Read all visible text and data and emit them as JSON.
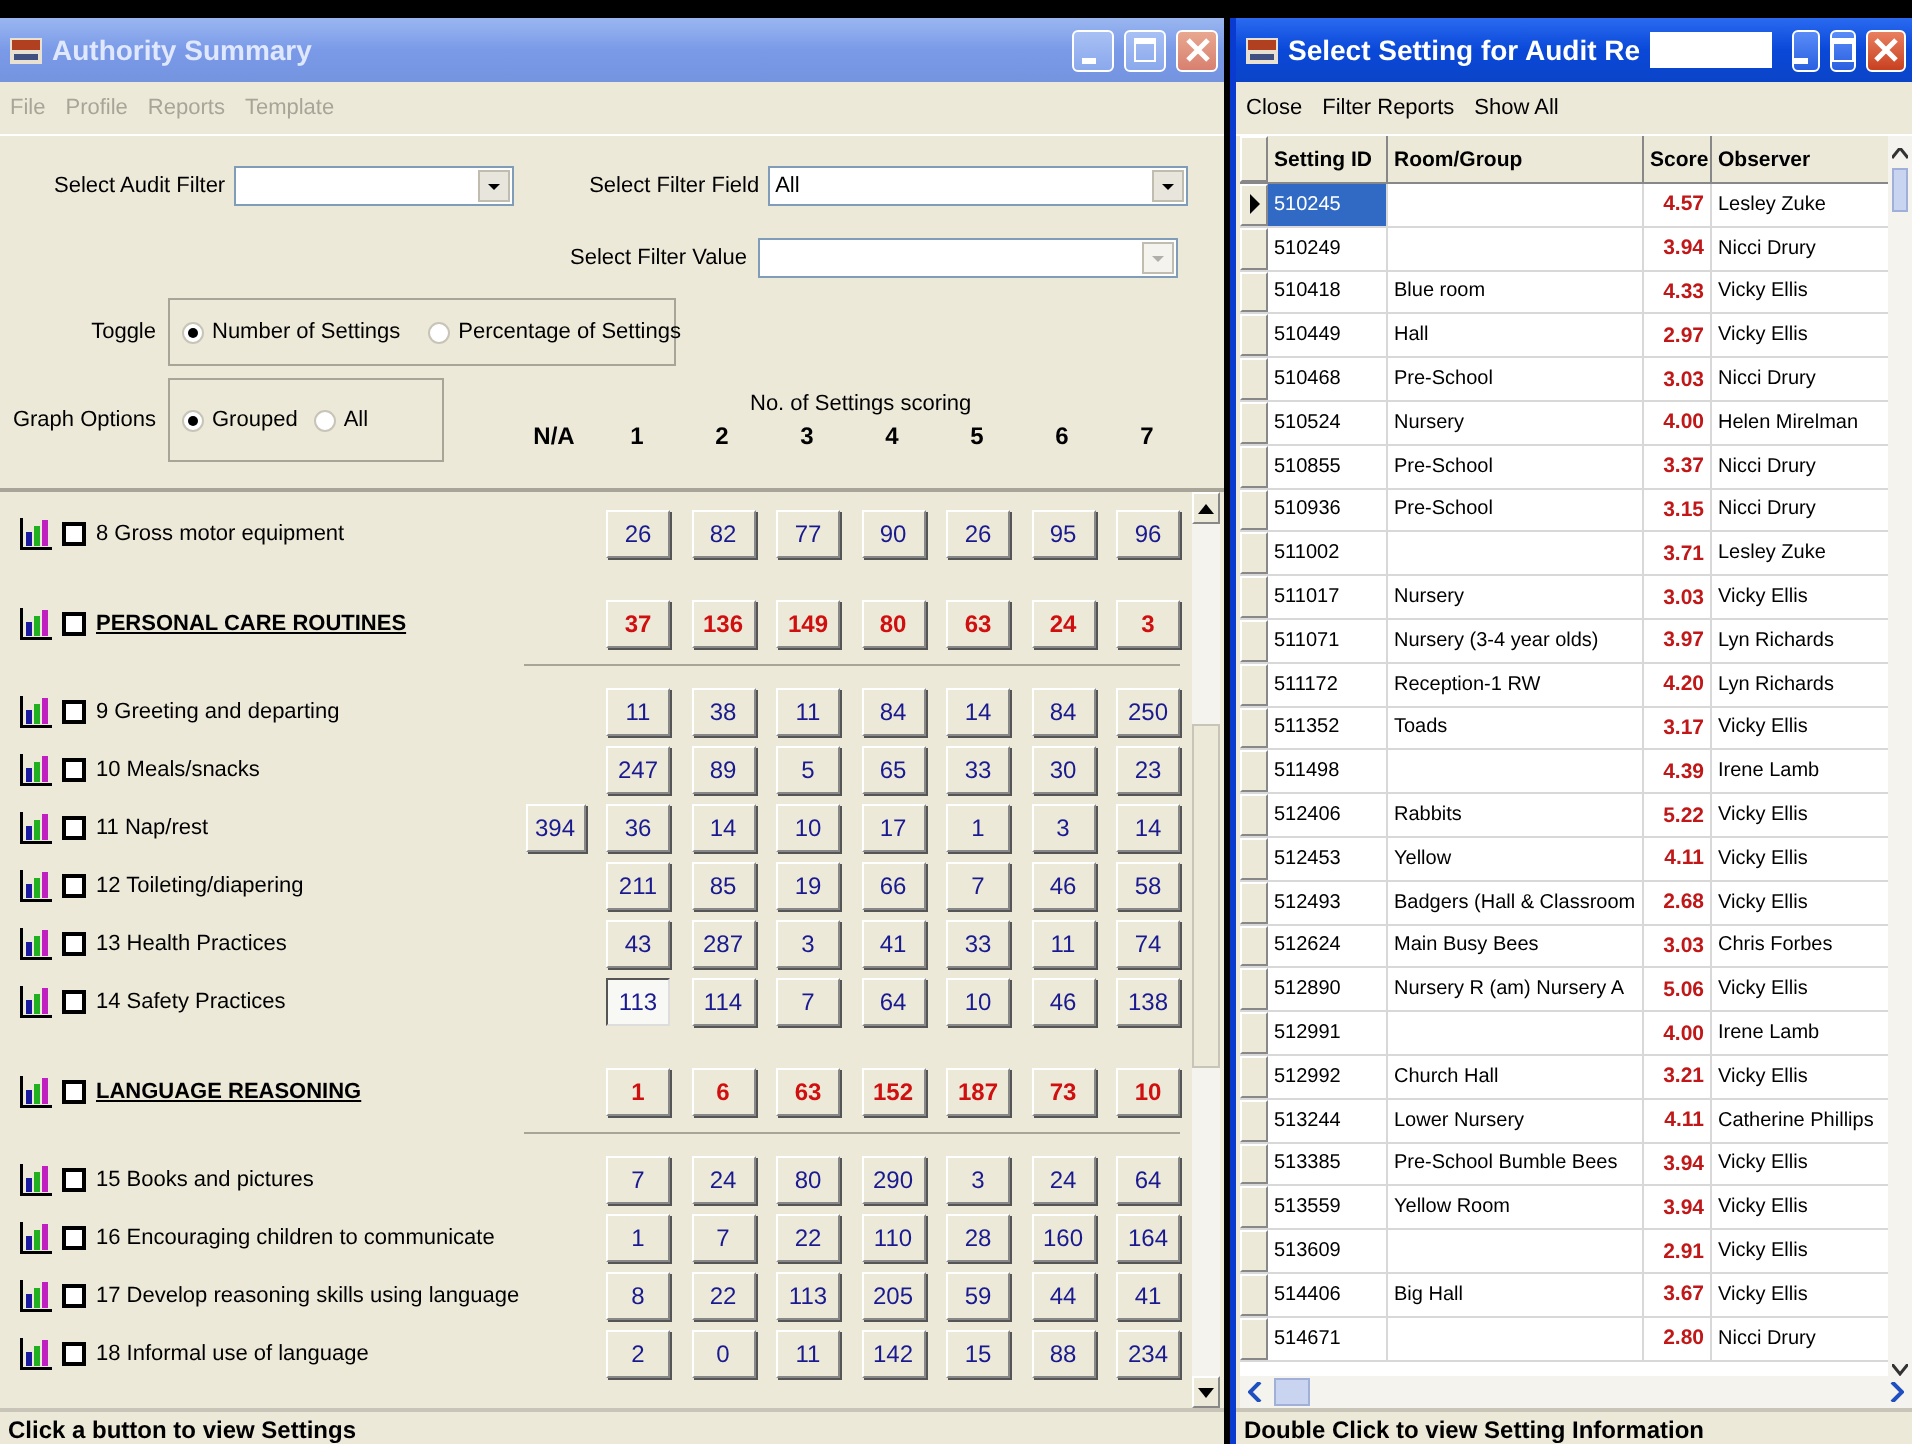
{
  "summary_window": {
    "title": "Authority Summary",
    "active": false,
    "menu": [
      {
        "label": "File",
        "disabled": true
      },
      {
        "label": "Profile",
        "disabled": true
      },
      {
        "label": "Reports",
        "disabled": true
      },
      {
        "label": "Template",
        "disabled": true
      }
    ],
    "audit_filter": {
      "label": "Select Audit Filter",
      "disabled": false
    },
    "filter_field": {
      "label": "Select Filter Field",
      "value": "All",
      "disabled": false
    },
    "filter_value": {
      "label": "Select Filter Value",
      "disabled": true
    },
    "toggle": {
      "label": "Toggle",
      "options": [
        {
          "label": "Number of Settings",
          "selected": true
        },
        {
          "label": "Percentage of Settings",
          "selected": false
        }
      ]
    },
    "graph_options": {
      "label": "Graph Options",
      "options": [
        {
          "label": "Grouped",
          "selected": true
        },
        {
          "label": "All",
          "selected": false
        }
      ]
    },
    "scores_caption": "No. of Settings scoring",
    "na_header": "N/A",
    "columns": [
      "1",
      "2",
      "3",
      "4",
      "5",
      "6",
      "7"
    ],
    "rows": [
      {
        "kind": "item",
        "label": "8  Gross motor equipment",
        "checked": false,
        "na": "",
        "cells": [
          {
            "text": "26",
            "selected": false
          },
          {
            "text": "82",
            "selected": false
          },
          {
            "text": "77",
            "selected": false
          },
          {
            "text": "90",
            "selected": false
          },
          {
            "text": "26",
            "selected": false
          },
          {
            "text": "95",
            "selected": false
          },
          {
            "text": "96",
            "selected": false
          }
        ]
      },
      {
        "kind": "group",
        "label": "PERSONAL CARE ROUTINES",
        "checked": false,
        "na": "",
        "cells": [
          {
            "text": "37",
            "selected": false
          },
          {
            "text": "136",
            "selected": false
          },
          {
            "text": "149",
            "selected": false
          },
          {
            "text": "80",
            "selected": false
          },
          {
            "text": "63",
            "selected": false
          },
          {
            "text": "24",
            "selected": false
          },
          {
            "text": "3",
            "selected": false
          }
        ]
      },
      {
        "kind": "item",
        "label": "9  Greeting and departing",
        "checked": false,
        "na": "",
        "cells": [
          {
            "text": "11",
            "selected": false
          },
          {
            "text": "38",
            "selected": false
          },
          {
            "text": "11",
            "selected": false
          },
          {
            "text": "84",
            "selected": false
          },
          {
            "text": "14",
            "selected": false
          },
          {
            "text": "84",
            "selected": false
          },
          {
            "text": "250",
            "selected": false
          }
        ]
      },
      {
        "kind": "item",
        "label": "10 Meals/snacks",
        "checked": false,
        "na": "",
        "cells": [
          {
            "text": "247",
            "selected": false
          },
          {
            "text": "89",
            "selected": false
          },
          {
            "text": "5",
            "selected": false
          },
          {
            "text": "65",
            "selected": false
          },
          {
            "text": "33",
            "selected": false
          },
          {
            "text": "30",
            "selected": false
          },
          {
            "text": "23",
            "selected": false
          }
        ]
      },
      {
        "kind": "item",
        "label": "11 Nap/rest",
        "checked": false,
        "na": "394",
        "cells": [
          {
            "text": "36",
            "selected": false
          },
          {
            "text": "14",
            "selected": false
          },
          {
            "text": "10",
            "selected": false
          },
          {
            "text": "17",
            "selected": false
          },
          {
            "text": "1",
            "selected": false
          },
          {
            "text": "3",
            "selected": false
          },
          {
            "text": "14",
            "selected": false
          }
        ]
      },
      {
        "kind": "item",
        "label": "12 Toileting/diapering",
        "checked": false,
        "na": "",
        "cells": [
          {
            "text": "211",
            "selected": false
          },
          {
            "text": "85",
            "selected": false
          },
          {
            "text": "19",
            "selected": false
          },
          {
            "text": "66",
            "selected": false
          },
          {
            "text": "7",
            "selected": false
          },
          {
            "text": "46",
            "selected": false
          },
          {
            "text": "58",
            "selected": false
          }
        ]
      },
      {
        "kind": "item",
        "label": "13 Health Practices",
        "checked": false,
        "na": "",
        "cells": [
          {
            "text": "43",
            "selected": false
          },
          {
            "text": "287",
            "selected": false
          },
          {
            "text": "3",
            "selected": false
          },
          {
            "text": "41",
            "selected": false
          },
          {
            "text": "33",
            "selected": false
          },
          {
            "text": "11",
            "selected": false
          },
          {
            "text": "74",
            "selected": false
          }
        ]
      },
      {
        "kind": "item",
        "label": "14 Safety Practices",
        "checked": false,
        "na": "",
        "cells": [
          {
            "text": "113",
            "selected": true
          },
          {
            "text": "114",
            "selected": false
          },
          {
            "text": "7",
            "selected": false
          },
          {
            "text": "64",
            "selected": false
          },
          {
            "text": "10",
            "selected": false
          },
          {
            "text": "46",
            "selected": false
          },
          {
            "text": "138",
            "selected": false
          }
        ]
      },
      {
        "kind": "group",
        "label": "LANGUAGE REASONING",
        "checked": false,
        "na": "",
        "cells": [
          {
            "text": "1",
            "selected": false
          },
          {
            "text": "6",
            "selected": false
          },
          {
            "text": "63",
            "selected": false
          },
          {
            "text": "152",
            "selected": false
          },
          {
            "text": "187",
            "selected": false
          },
          {
            "text": "73",
            "selected": false
          },
          {
            "text": "10",
            "selected": false
          }
        ]
      },
      {
        "kind": "item",
        "label": "15 Books and pictures",
        "checked": false,
        "na": "",
        "cells": [
          {
            "text": "7",
            "selected": false
          },
          {
            "text": "24",
            "selected": false
          },
          {
            "text": "80",
            "selected": false
          },
          {
            "text": "290",
            "selected": false
          },
          {
            "text": "3",
            "selected": false
          },
          {
            "text": "24",
            "selected": false
          },
          {
            "text": "64",
            "selected": false
          }
        ]
      },
      {
        "kind": "item",
        "label": "16 Encouraging children to communicate",
        "checked": false,
        "na": "",
        "cells": [
          {
            "text": "1",
            "selected": false
          },
          {
            "text": "7",
            "selected": false
          },
          {
            "text": "22",
            "selected": false
          },
          {
            "text": "110",
            "selected": false
          },
          {
            "text": "28",
            "selected": false
          },
          {
            "text": "160",
            "selected": false
          },
          {
            "text": "164",
            "selected": false
          }
        ]
      },
      {
        "kind": "item",
        "label": "17 Develop reasoning skills using language",
        "checked": false,
        "na": "",
        "cells": [
          {
            "text": "8",
            "selected": false
          },
          {
            "text": "22",
            "selected": false
          },
          {
            "text": "113",
            "selected": false
          },
          {
            "text": "205",
            "selected": false
          },
          {
            "text": "59",
            "selected": false
          },
          {
            "text": "44",
            "selected": false
          },
          {
            "text": "41",
            "selected": false
          }
        ]
      },
      {
        "kind": "item",
        "label": "18 Informal use of language",
        "checked": false,
        "na": "",
        "cells": [
          {
            "text": "2",
            "selected": false
          },
          {
            "text": "0",
            "selected": false
          },
          {
            "text": "11",
            "selected": false
          },
          {
            "text": "142",
            "selected": false
          },
          {
            "text": "15",
            "selected": false
          },
          {
            "text": "88",
            "selected": false
          },
          {
            "text": "234",
            "selected": false
          }
        ]
      }
    ],
    "status_bar": "Click a button to view Settings"
  },
  "settings_window": {
    "title": "Select Setting for Audit Re",
    "redacted": true,
    "active": true,
    "menu": [
      {
        "label": "Close",
        "disabled": false
      },
      {
        "label": "Filter Reports",
        "disabled": false
      },
      {
        "label": "Show All",
        "disabled": false
      }
    ],
    "columns": [
      "Setting ID",
      "Room/Group",
      "Score",
      "Observer"
    ],
    "rows": [
      {
        "id": "510245",
        "room": "",
        "score": "4.57",
        "observer": "Lesley Zuke",
        "selected": true
      },
      {
        "id": "510249",
        "room": "",
        "score": "3.94",
        "observer": "Nicci Drury",
        "selected": false
      },
      {
        "id": "510418",
        "room": "Blue room",
        "score": "4.33",
        "observer": "Vicky Ellis",
        "selected": false
      },
      {
        "id": "510449",
        "room": "Hall",
        "score": "2.97",
        "observer": "Vicky Ellis",
        "selected": false
      },
      {
        "id": "510468",
        "room": "Pre-School",
        "score": "3.03",
        "observer": "Nicci Drury",
        "selected": false
      },
      {
        "id": "510524",
        "room": "Nursery",
        "score": "4.00",
        "observer": "Helen Mirelman",
        "selected": false
      },
      {
        "id": "510855",
        "room": "Pre-School",
        "score": "3.37",
        "observer": "Nicci Drury",
        "selected": false
      },
      {
        "id": "510936",
        "room": "Pre-School",
        "score": "3.15",
        "observer": "Nicci Drury",
        "selected": false
      },
      {
        "id": "511002",
        "room": "",
        "score": "3.71",
        "observer": "Lesley Zuke",
        "selected": false
      },
      {
        "id": "511017",
        "room": "Nursery",
        "score": "3.03",
        "observer": "Vicky Ellis",
        "selected": false
      },
      {
        "id": "511071",
        "room": "Nursery (3-4 year olds)",
        "score": "3.97",
        "observer": "Lyn Richards",
        "selected": false
      },
      {
        "id": "511172",
        "room": "Reception-1 RW",
        "score": "4.20",
        "observer": "Lyn Richards",
        "selected": false
      },
      {
        "id": "511352",
        "room": "Toads",
        "score": "3.17",
        "observer": "Vicky Ellis",
        "selected": false
      },
      {
        "id": "511498",
        "room": "",
        "score": "4.39",
        "observer": "Irene Lamb",
        "selected": false
      },
      {
        "id": "512406",
        "room": "Rabbits",
        "score": "5.22",
        "observer": "Vicky Ellis",
        "selected": false
      },
      {
        "id": "512453",
        "room": "Yellow",
        "score": "4.11",
        "observer": "Vicky Ellis",
        "selected": false
      },
      {
        "id": "512493",
        "room": "Badgers (Hall & Classroom",
        "score": "2.68",
        "observer": "Vicky Ellis",
        "selected": false
      },
      {
        "id": "512624",
        "room": "Main Busy Bees",
        "score": "3.03",
        "observer": "Chris Forbes",
        "selected": false
      },
      {
        "id": "512890",
        "room": "Nursery R (am)  Nursery A",
        "score": "5.06",
        "observer": "Vicky Ellis",
        "selected": false
      },
      {
        "id": "512991",
        "room": "",
        "score": "4.00",
        "observer": "Irene Lamb",
        "selected": false
      },
      {
        "id": "512992",
        "room": "Church Hall",
        "score": "3.21",
        "observer": "Vicky Ellis",
        "selected": false
      },
      {
        "id": "513244",
        "room": "Lower Nursery",
        "score": "4.11",
        "observer": "Catherine Phillips",
        "selected": false
      },
      {
        "id": "513385",
        "room": "Pre-School Bumble Bees",
        "score": "3.94",
        "observer": "Vicky Ellis",
        "selected": false
      },
      {
        "id": "513559",
        "room": "Yellow Room",
        "score": "3.94",
        "observer": "Vicky Ellis",
        "selected": false
      },
      {
        "id": "513609",
        "room": "",
        "score": "2.91",
        "observer": "Vicky Ellis",
        "selected": false
      },
      {
        "id": "514406",
        "room": "Big Hall",
        "score": "3.67",
        "observer": "Vicky Ellis",
        "selected": false
      },
      {
        "id": "514671",
        "room": "",
        "score": "2.80",
        "observer": "Nicci Drury",
        "selected": false
      }
    ],
    "status_bar": "Double Click to view Setting Information"
  }
}
